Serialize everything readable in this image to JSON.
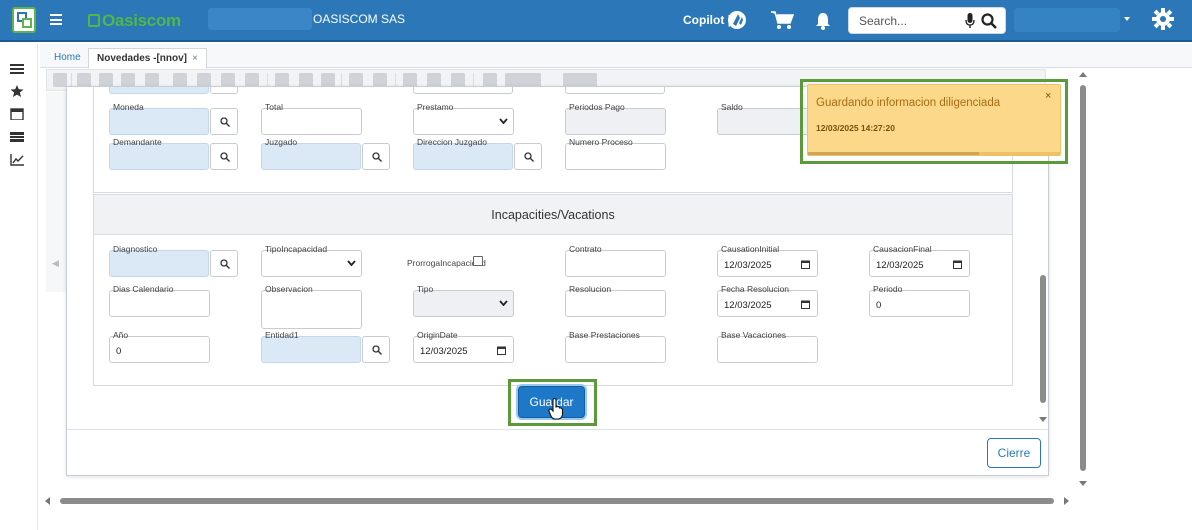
{
  "header": {
    "brand": "Oasiscom",
    "company": "OASISCOM SAS",
    "copilot": "Copilot |",
    "search_placeholder": "Search..."
  },
  "tabs": [
    {
      "label": "Home"
    },
    {
      "label": "Novedades -[nnov]",
      "close": "×"
    }
  ],
  "form": {
    "top_fields": {
      "moneda": "Moneda",
      "total": "Total",
      "prestamo": "Prestamo",
      "periodos_pago": "Periodos Pago",
      "saldo": "Saldo",
      "demandante": "Demandante",
      "juzgado": "Juzgado",
      "direccion_juzgado": "Direccion Juzgado",
      "numero_proceso": "Numero Proceso"
    },
    "section_title": "Incapacities/Vacations",
    "fields": {
      "diagnostico": "Diagnostico",
      "tipo_incapacidad": "TipoIncapacidad",
      "prorroga_incapacidad": "ProrrogaIncapacidad",
      "contrato": "Contrato",
      "causation_initial": {
        "label": "CausationInitial",
        "value": "12/03/2025"
      },
      "causacion_final": {
        "label": "CausacionFinal",
        "value": "12/03/2025"
      },
      "dias_calendario": "Dias Calendario",
      "observacion": "Observacion",
      "tipo": "Tipo",
      "resolucion": "Resolucion",
      "fecha_resolucion": {
        "label": "Fecha Resolucion",
        "value": "12/03/2025"
      },
      "periodo": {
        "label": "Periodo",
        "value": "0"
      },
      "anio": {
        "label": "Año",
        "value": "0"
      },
      "entidad1": "Entidad1",
      "origin_date": {
        "label": "OriginDate",
        "value": "12/03/2025"
      },
      "base_prestaciones": "Base Prestaciones",
      "base_vacaciones": "Base Vacaciones"
    },
    "save_label": "Guardar",
    "close_label": "Cierre"
  },
  "toast": {
    "message": "Guardando informacion diligenciada",
    "time": "12/03/2025 14:27:20",
    "close": "×",
    "progress": 0.68
  },
  "colors": {
    "topbar": "#2c77b8",
    "brand_green": "#4fb848",
    "toast_bg": "#fbd88a",
    "highlight": "#5a9a3a",
    "save_button": "#1e78c8"
  }
}
